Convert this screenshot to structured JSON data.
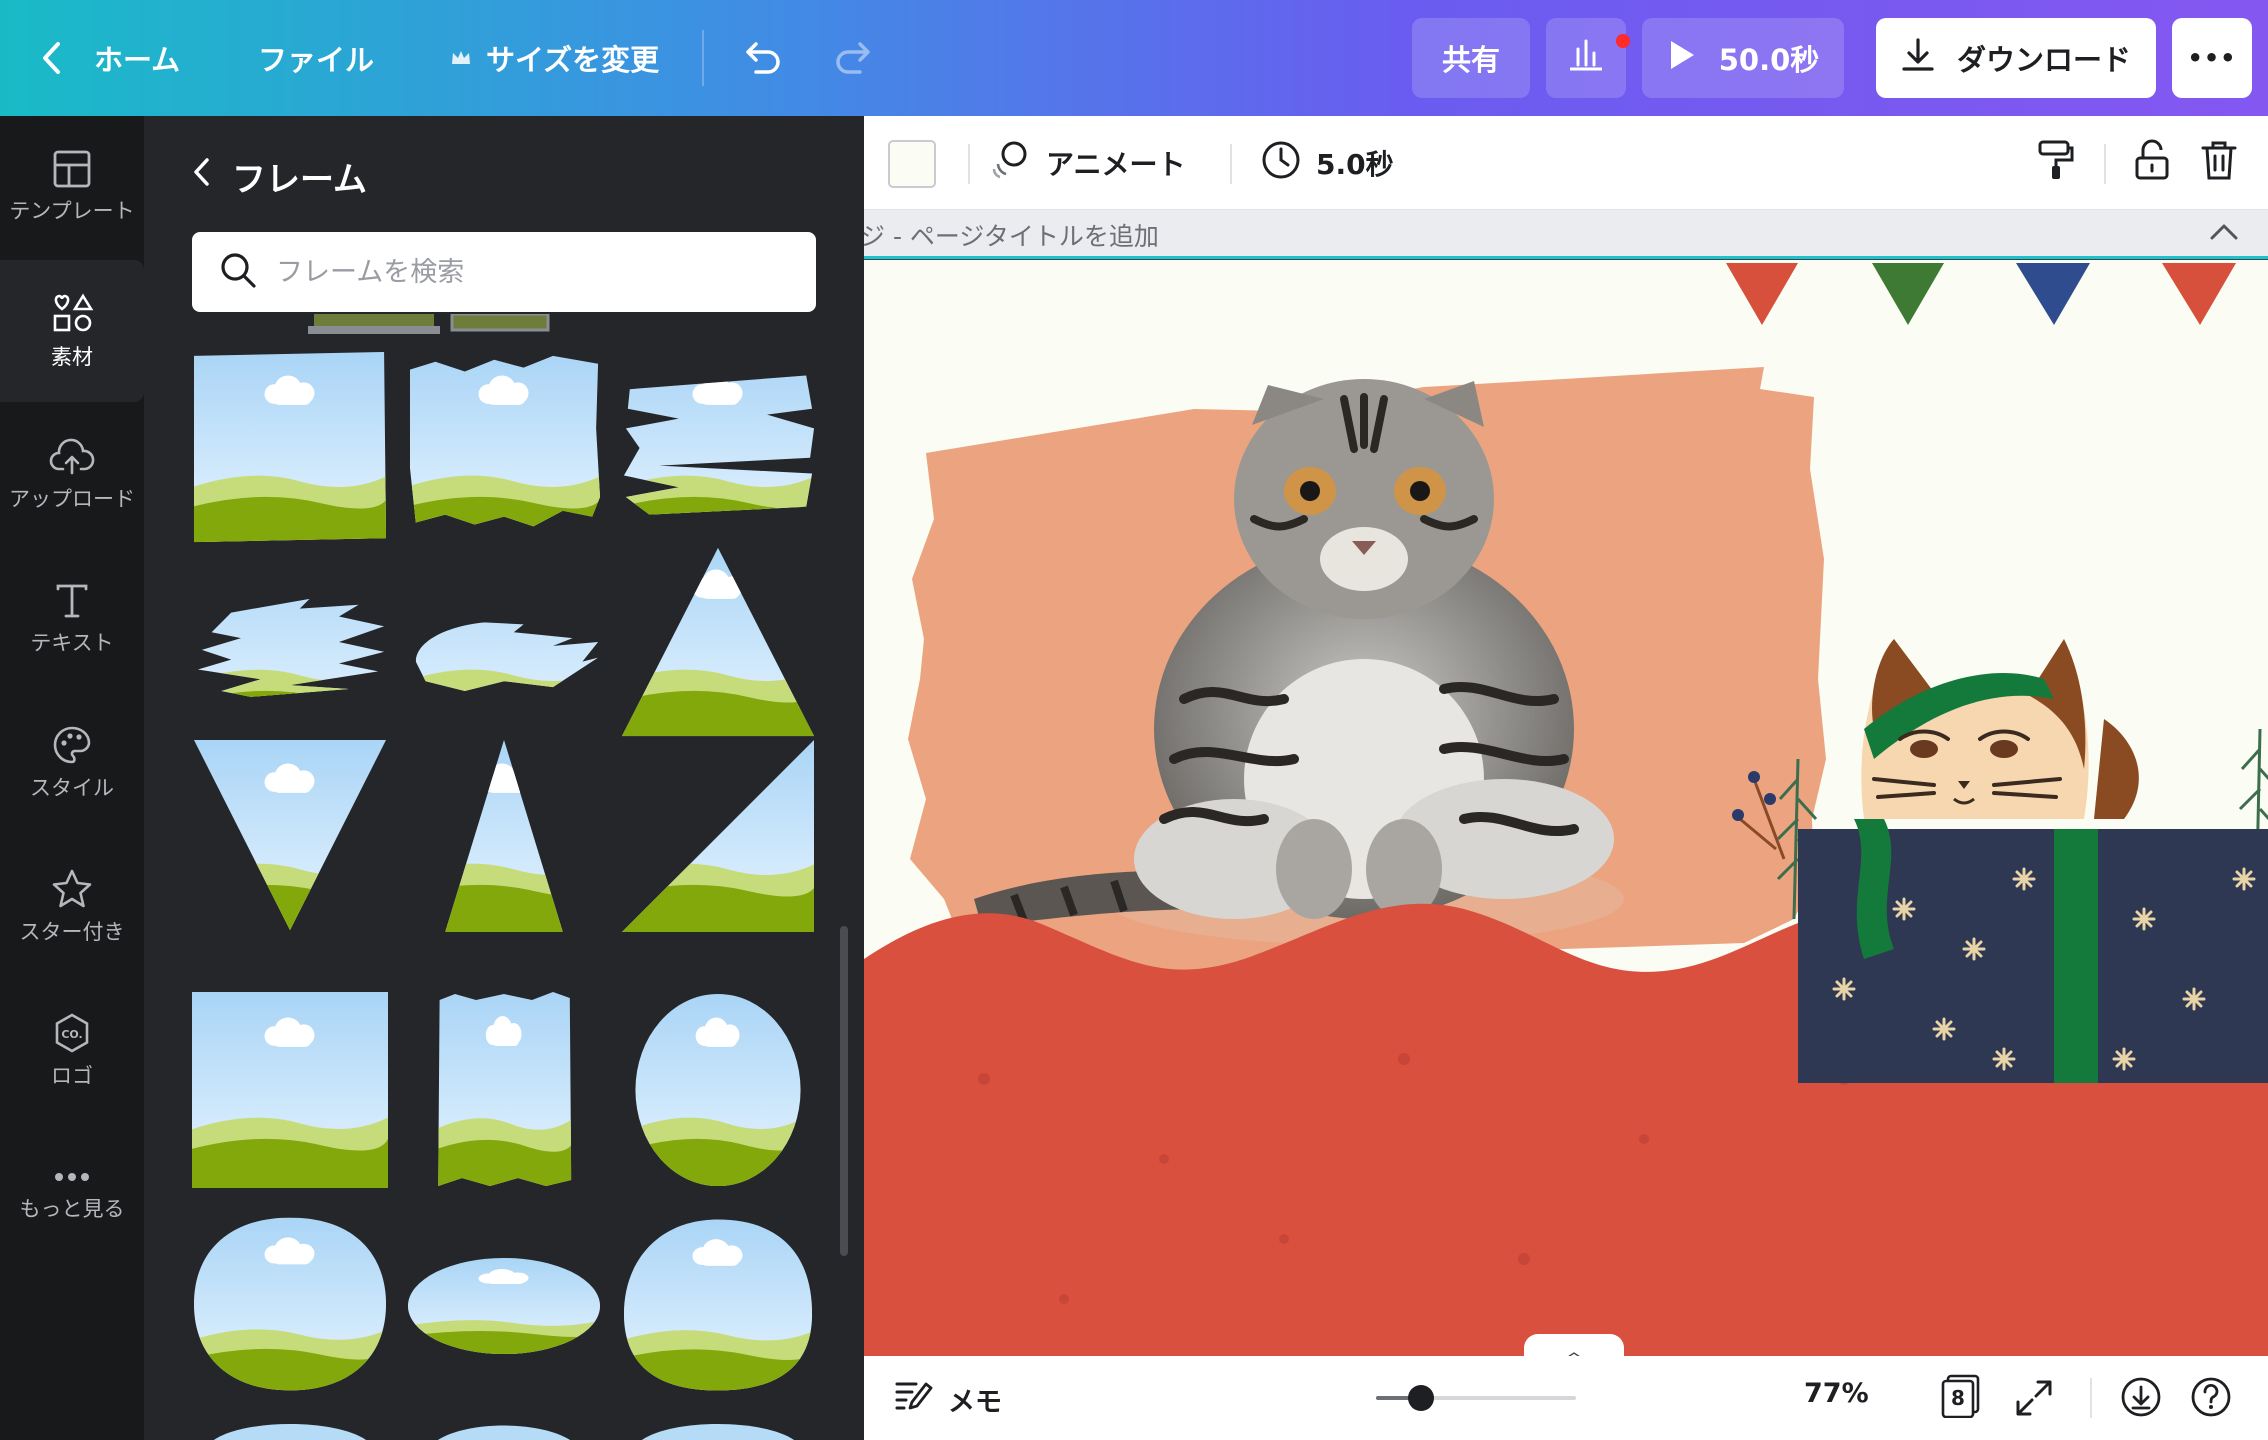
{
  "topbar": {
    "home_label": "ホーム",
    "file_label": "ファイル",
    "resize_label": "サイズを変更",
    "share_label": "共有",
    "play_label": "50.0秒",
    "download_label": "ダウンロード",
    "more_label": "•••"
  },
  "rail": [
    {
      "label": "テンプレート",
      "icon": "layout-icon"
    },
    {
      "label": "素材",
      "icon": "shapes-icon"
    },
    {
      "label": "アップロード",
      "icon": "cloud-upload-icon"
    },
    {
      "label": "テキスト",
      "icon": "text-icon"
    },
    {
      "label": "スタイル",
      "icon": "palette-icon"
    },
    {
      "label": "スター付き",
      "icon": "star-icon"
    },
    {
      "label": "ロゴ",
      "icon": "logo-icon"
    },
    {
      "label": "もっと見る",
      "icon": "more-icon"
    }
  ],
  "panel": {
    "title": "フレーム",
    "search_placeholder": "フレームを検索"
  },
  "toolbar": {
    "animate_label": "アニメート",
    "duration_label": "5.0秒"
  },
  "page": {
    "title_placeholder": "ジ - ページタイトルを追加"
  },
  "bottombar": {
    "notes_label": "メモ",
    "zoom_label": "77%",
    "page_count": "8"
  },
  "colors": {
    "accent": "#19c4cf",
    "red_dot": "#ff2a2a",
    "canvas_bg": "#fbfcf3",
    "wave_red": "#d9503f",
    "gift_navy": "#2f3853",
    "ribbon_green": "#137a3b"
  }
}
